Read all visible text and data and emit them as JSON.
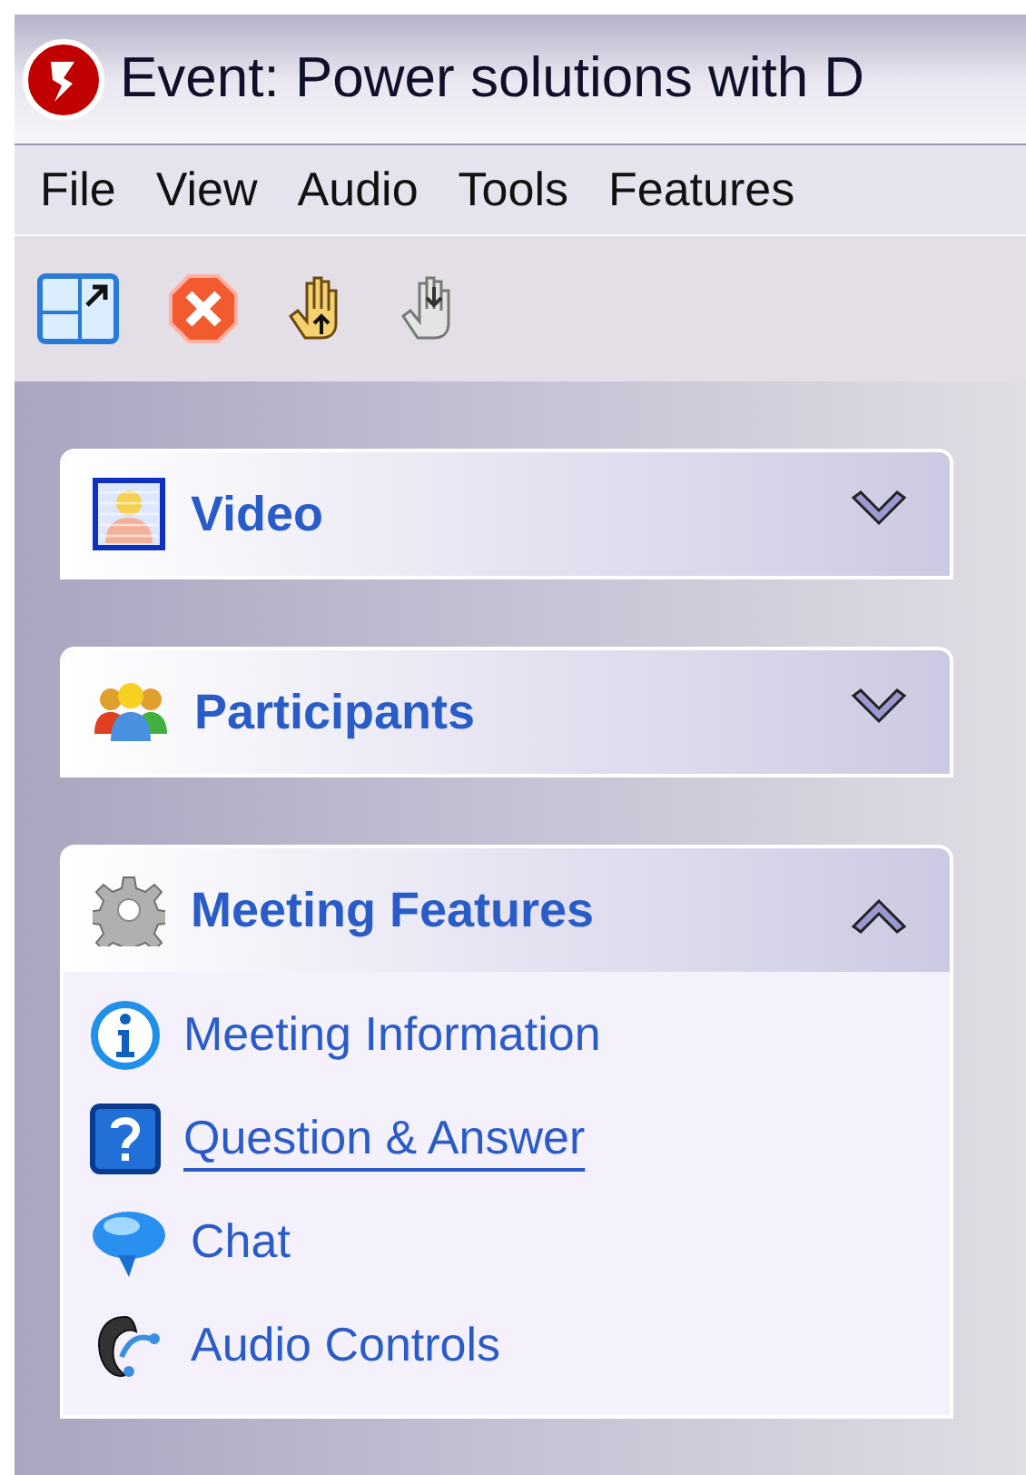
{
  "window": {
    "title": "Event: Power solutions with D"
  },
  "menu": [
    "File",
    "View",
    "Audio",
    "Tools",
    "Features"
  ],
  "toolbar": [
    {
      "kind": "restore"
    },
    {
      "kind": "leave"
    },
    {
      "kind": "raise-hand"
    },
    {
      "kind": "lower-hand"
    }
  ],
  "panels": [
    {
      "title": "Video",
      "kind": "video",
      "expanded": false
    },
    {
      "title": "Participants",
      "kind": "people",
      "expanded": false
    },
    {
      "title": "Meeting Features",
      "kind": "gear",
      "expanded": true,
      "items": [
        {
          "label": "Meeting Information",
          "kind": "info",
          "selected": false
        },
        {
          "label": "Question & Answer",
          "kind": "question",
          "selected": true
        },
        {
          "label": "Chat",
          "kind": "chat",
          "selected": false
        },
        {
          "label": "Audio Controls",
          "kind": "audio",
          "selected": false
        }
      ]
    }
  ]
}
